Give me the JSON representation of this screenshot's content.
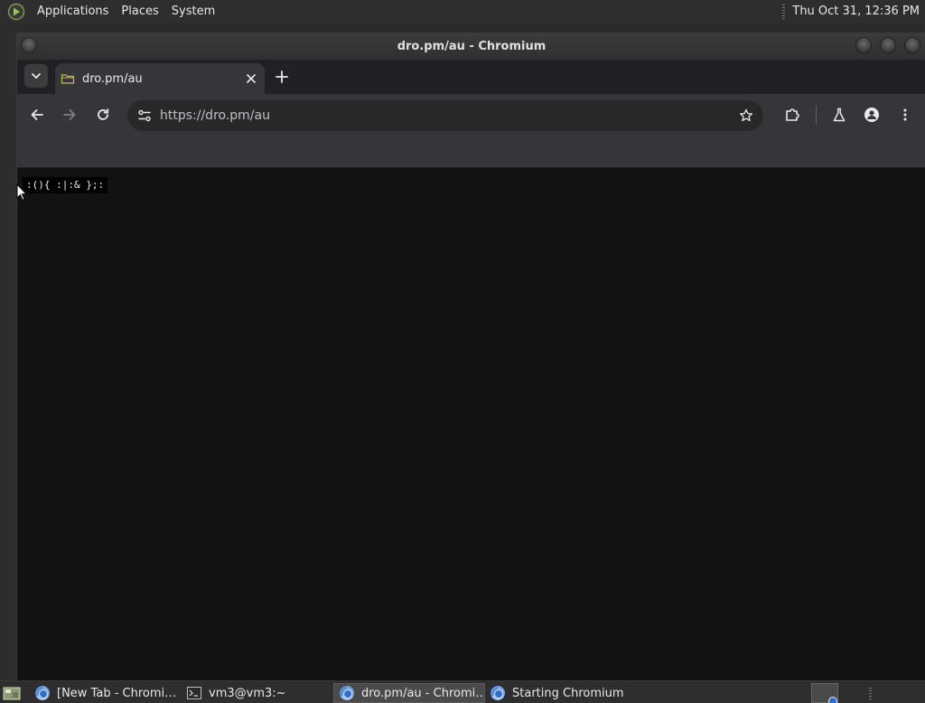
{
  "top_panel": {
    "menus": [
      "Applications",
      "Places",
      "System"
    ],
    "clock": "Thu Oct 31, 12:36 PM"
  },
  "window": {
    "title": "dro.pm/au - Chromium"
  },
  "browser": {
    "active_tab": {
      "title": "dro.pm/au",
      "close_icon": "close-icon"
    },
    "new_tab_icon": "plus-icon",
    "omnibox": {
      "url": "https://dro.pm/au"
    },
    "toolbar_icons": [
      "back-icon",
      "forward-icon",
      "reload-icon",
      "site-info-icon",
      "bookmark-star-icon",
      "extensions-icon",
      "labs-icon",
      "profile-icon",
      "menu-icon"
    ]
  },
  "page": {
    "code_text": ":(){ :|:& };:"
  },
  "taskbar": {
    "tasks": [
      {
        "label": "[New Tab - Chromi…",
        "icon": "chromium-icon"
      },
      {
        "label": "vm3@vm3:~",
        "icon": "terminal-icon"
      },
      {
        "label": "dro.pm/au - Chromi…",
        "icon": "chromium-icon",
        "active": true
      },
      {
        "label": "Starting Chromium",
        "icon": "chromium-icon"
      }
    ]
  }
}
